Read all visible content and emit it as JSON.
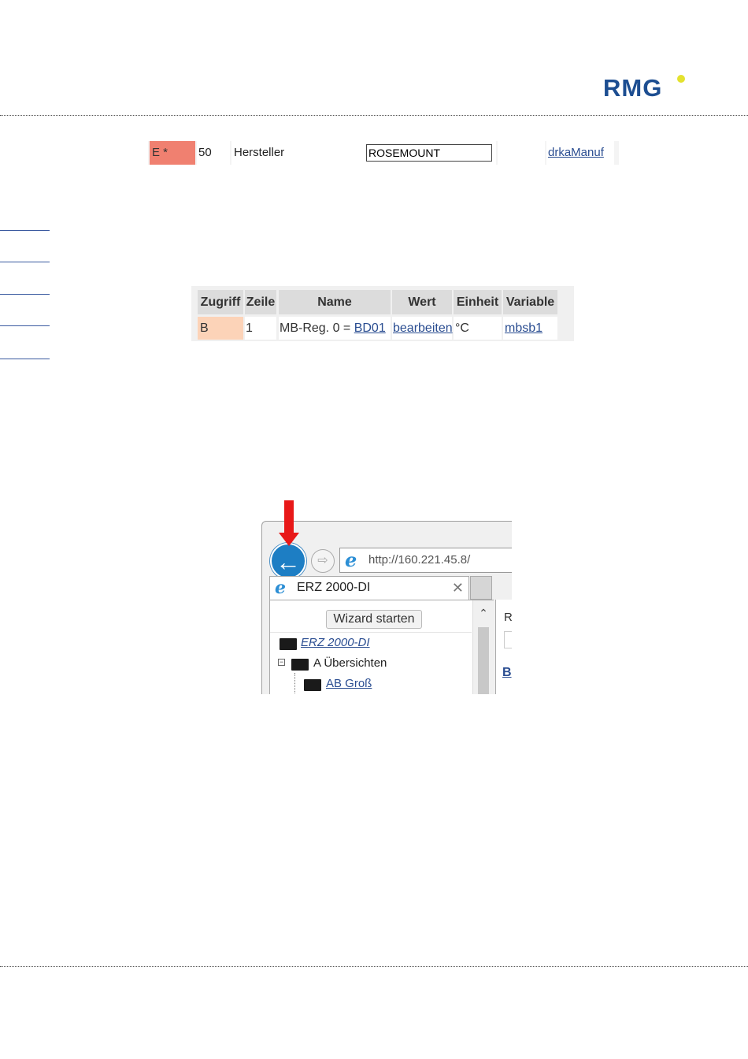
{
  "logo": {
    "text": "RMG",
    "accent_color": "#e4e22f",
    "brand_color": "#1d4e91"
  },
  "row1": {
    "access": "E *",
    "line": "50",
    "name": "Hersteller",
    "value": "ROSEMOUNT",
    "unit": "",
    "variable": "drkaManuf"
  },
  "table2": {
    "headers": [
      "Zugriff",
      "Zeile",
      "Name",
      "Wert",
      "Einheit",
      "Variable"
    ],
    "row": {
      "access": "B",
      "line": "1",
      "name_prefix": "MB-Reg. 0 = ",
      "name_link": "BD01",
      "value": "bearbeiten",
      "unit": "°C",
      "variable": "mbsb1"
    }
  },
  "browser": {
    "address": "http://160.221.45.8/",
    "tab_title": "ERZ 2000-DI",
    "wizard_button": "Wizard starten",
    "tree": [
      {
        "label": "ERZ 2000-DI",
        "style": "link-italic"
      },
      {
        "label": "A Übersichten",
        "style": "plain"
      },
      {
        "label": "AB Groß",
        "style": "link"
      }
    ],
    "right_pane_letters": [
      "R",
      "B"
    ]
  }
}
